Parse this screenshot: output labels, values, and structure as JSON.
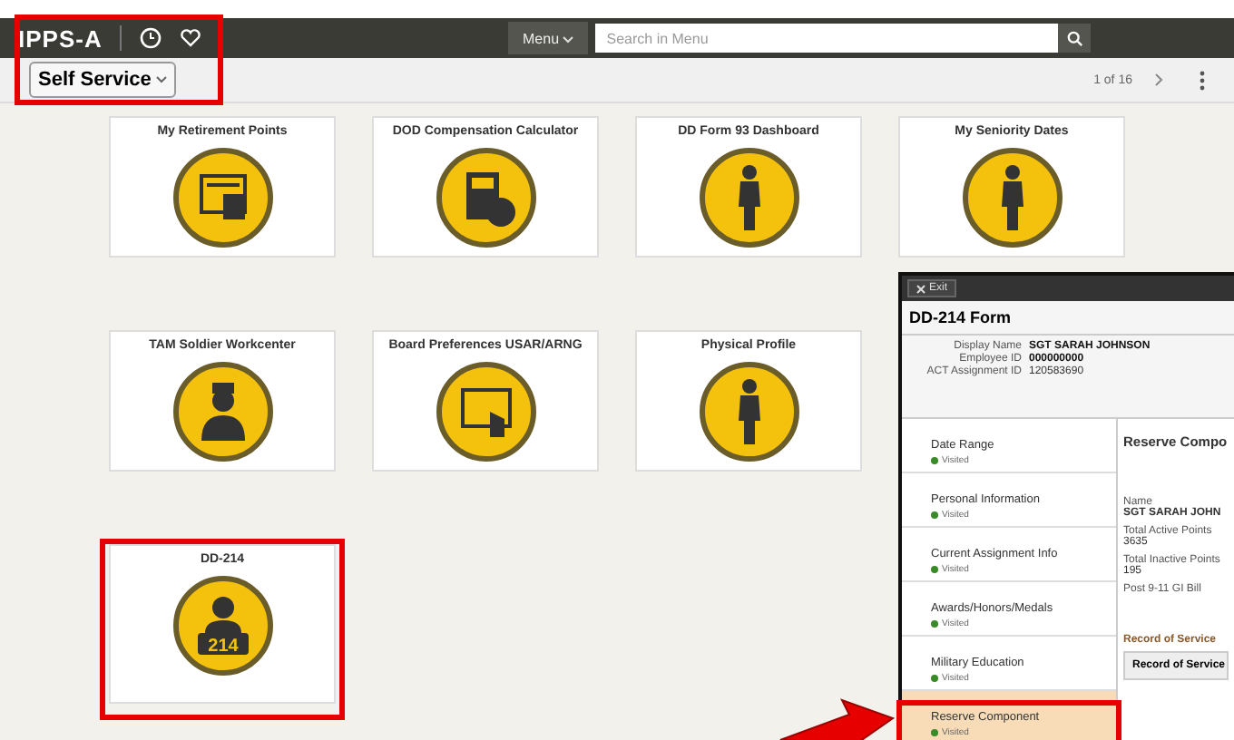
{
  "header": {
    "logo": "IPPS-A",
    "menu_button": "Menu",
    "search": {
      "placeholder": "Search in Menu"
    }
  },
  "subbar": {
    "homepage": "Self Service",
    "pager": "1 of 16"
  },
  "tile_rows": [
    [
      {
        "title": "My Retirement Points"
      },
      {
        "title": "DOD Compensation Calculator"
      },
      {
        "title": "DD Form 93 Dashboard"
      },
      {
        "title": "My Seniority Dates"
      }
    ],
    [
      {
        "title": "TAM Soldier Workcenter"
      },
      {
        "title": "Board Preferences USAR/ARNG"
      },
      {
        "title": "Physical Profile"
      }
    ],
    [
      {
        "title": "DD-214",
        "badge_text": "214"
      }
    ]
  ],
  "form_window": {
    "exit_button": "Exit",
    "title": "DD-214 Form",
    "info": [
      {
        "label": "Display Name",
        "value": "SGT SARAH JOHNSON",
        "bold": true
      },
      {
        "label": "Employee ID",
        "value": "000000000",
        "bold": true
      },
      {
        "label": "ACT Assignment ID",
        "value": "120583690",
        "bold": false
      }
    ],
    "steps": [
      {
        "label": "Date Range",
        "status": "Visited",
        "selected": false
      },
      {
        "label": "Personal Information",
        "status": "Visited",
        "selected": false
      },
      {
        "label": "Current Assignment Info",
        "status": "Visited",
        "selected": false
      },
      {
        "label": "Awards/Honors/Medals",
        "status": "Visited",
        "selected": false
      },
      {
        "label": "Military Education",
        "status": "Visited",
        "selected": false
      },
      {
        "label": "Reserve Component",
        "status": "Visited",
        "selected": true
      }
    ],
    "content": {
      "heading": "Reserve Compo",
      "fields": [
        {
          "label": "Name",
          "value": "SGT SARAH JOHN"
        },
        {
          "label": "Total Active Points",
          "value": "3635"
        },
        {
          "label": "Total Inactive Points",
          "value": "195"
        },
        {
          "label": "Post 9-11 GI Bill"
        }
      ],
      "section_title": "Record of Service",
      "table_column": "Record of Service"
    }
  }
}
